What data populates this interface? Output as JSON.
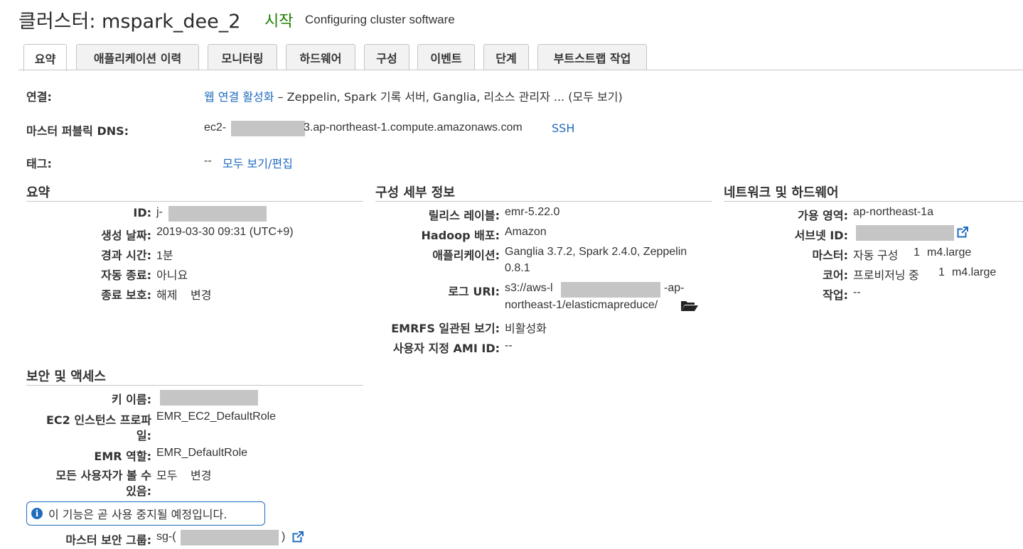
{
  "header": {
    "title": "클러스터: mspark_dee_2",
    "status": "시작",
    "status_detail": "Configuring cluster software"
  },
  "tabs": [
    {
      "label": "요약",
      "active": true
    },
    {
      "label": "애플리케이션 이력"
    },
    {
      "label": "모니터링"
    },
    {
      "label": "하드웨어"
    },
    {
      "label": "구성"
    },
    {
      "label": "이벤트"
    },
    {
      "label": "단계"
    },
    {
      "label": "부트스트랩 작업"
    }
  ],
  "connection": {
    "label": "연결:",
    "link": "웹 연결 활성화",
    "rest": "– Zeppelin, Spark 기록 서버, Ganglia, 리소스 관리자 ... (모두 보기)"
  },
  "master_dns": {
    "label": "마스터 퍼블릭 DNS:",
    "prefix": "ec2-",
    "suffix": "3.ap-northeast-1.compute.amazonaws.com",
    "ssh": "SSH"
  },
  "tags": {
    "label": "태그:",
    "value": "--",
    "link": "모두 보기/편집"
  },
  "summary": {
    "heading": "요약",
    "id_label": "ID:",
    "id_prefix": "j-",
    "created_label": "생성 날짜:",
    "created_value": "2019-03-30 09:31 (UTC+9)",
    "elapsed_label": "경과 시간:",
    "elapsed_value": "1분",
    "auto_term_label": "자동 종료:",
    "auto_term_value": "아니요",
    "term_protect_label": "종료 보호:",
    "term_protect_value": "해제",
    "term_protect_link": "변경"
  },
  "config": {
    "heading": "구성 세부 정보",
    "release_label": "릴리스 레이블:",
    "release_value": "emr-5.22.0",
    "hadoop_label": "Hadoop 배포:",
    "hadoop_value": "Amazon",
    "apps_label": "애플리케이션:",
    "apps_line1": "Ganglia 3.7.2, Spark 2.4.0, Zeppelin",
    "apps_line2": "0.8.1",
    "log_label": "로그 URI:",
    "log_prefix": "s3://aws-l",
    "log_mid": "-ap-",
    "log_line2": "northeast-1/elasticmapreduce/",
    "emrfs_label": "EMRFS 일관된 보기:",
    "emrfs_value": "비활성화",
    "ami_label": "사용자 지정 AMI ID:",
    "ami_value": "--"
  },
  "network": {
    "heading": "네트워크 및 하드웨어",
    "az_label": "가용 영역:",
    "az_value": "ap-northeast-1a",
    "subnet_label": "서브넷 ID:",
    "master_label": "마스터:",
    "master_status": "자동 구성",
    "master_count": "1",
    "master_type": "m4.large",
    "core_label": "코어:",
    "core_status": "프로비저닝 중",
    "core_count": "1",
    "core_type": "m4.large",
    "task_label": "작업:",
    "task_value": "--"
  },
  "security": {
    "heading": "보안 및 액세스",
    "key_label": "키 이름:",
    "ec2_profile_label_1": "EC2 인스턴스 프로파",
    "ec2_profile_label_2": "일:",
    "ec2_profile_value": "EMR_EC2_DefaultRole",
    "emr_role_label": "EMR 역할:",
    "emr_role_value": "EMR_DefaultRole",
    "visible_label_1": "모든 사용자가 볼 수",
    "visible_label_2": "있음:",
    "visible_value": "모두",
    "visible_link": "변경",
    "notice": "이 기능은 곧 사용 중지될 예정입니다.",
    "master_sg_label": "마스터 보안 그룹:",
    "master_sg_prefix": "sg-(",
    "master_sg_suffix": ")"
  },
  "colors": {
    "link": "#1f6bbd",
    "status_green": "#1d8102",
    "orange": "#e07700",
    "redaction": "#c5c5c5"
  }
}
